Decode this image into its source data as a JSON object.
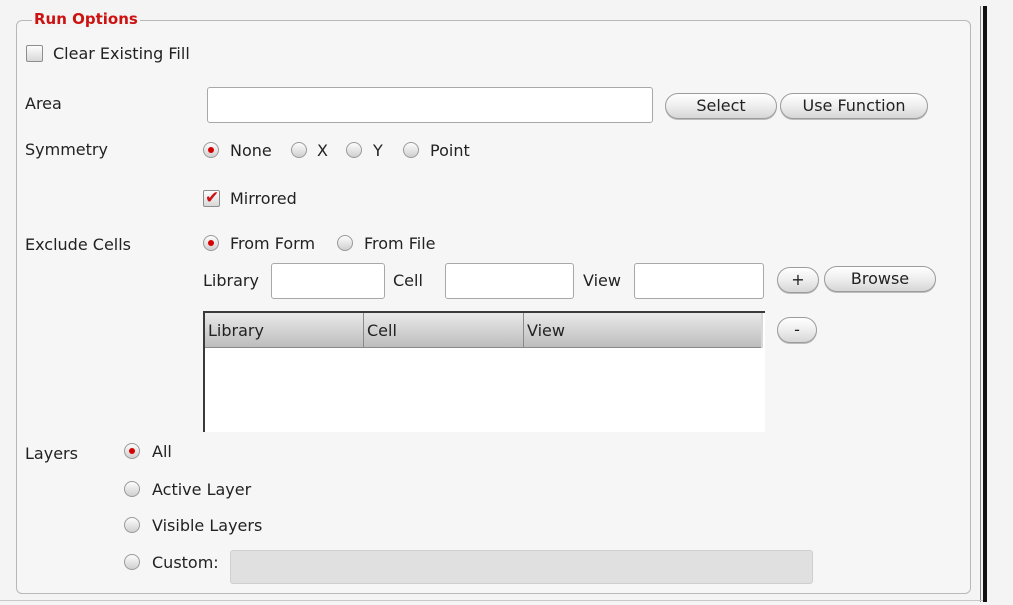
{
  "run_options": {
    "title": "Run Options",
    "clear_existing_fill": {
      "label": "Clear Existing Fill",
      "checked": false
    },
    "area": {
      "label": "Area",
      "value": "",
      "select_label": "Select",
      "use_function_label": "Use Function"
    },
    "symmetry": {
      "label": "Symmetry",
      "options": [
        "None",
        "X",
        "Y",
        "Point"
      ],
      "selected": "None",
      "mirrored": {
        "label": "Mirrored",
        "checked": true
      }
    },
    "exclude_cells": {
      "label": "Exclude Cells",
      "options": [
        "From Form",
        "From File"
      ],
      "selected": "From Form",
      "library_label": "Library",
      "cell_label": "Cell",
      "view_label": "View",
      "library_value": "",
      "cell_value": "",
      "view_value": "",
      "add_label": "+",
      "remove_label": "-",
      "browse_label": "Browse",
      "table_columns": [
        "Library",
        "Cell",
        "View"
      ],
      "table_rows": []
    },
    "layers": {
      "label": "Layers",
      "options": [
        "All",
        "Active Layer",
        "Visible Layers",
        "Custom:"
      ],
      "selected": "All",
      "custom_value": ""
    }
  },
  "colors": {
    "accent": "#cc1111",
    "radio_selected": "#d40000"
  }
}
